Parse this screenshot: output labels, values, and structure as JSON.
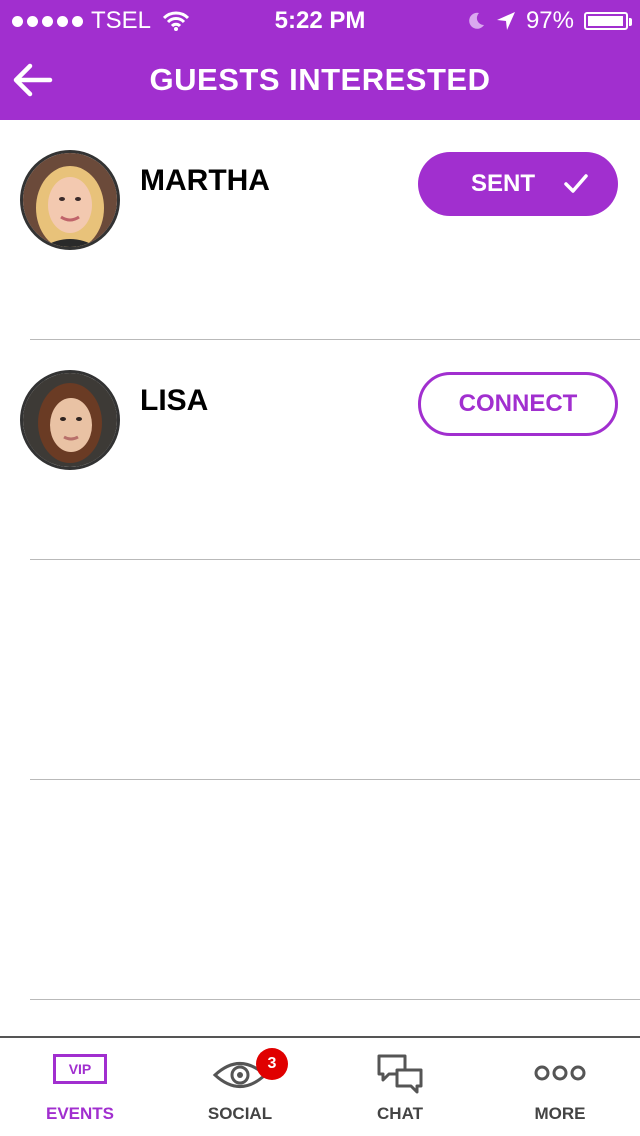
{
  "status_bar": {
    "carrier": "TSEL",
    "time": "5:22 PM",
    "battery": "97%",
    "battery_level": 0.97,
    "icons": [
      "signal-dots-icon",
      "wifi-icon",
      "moon-icon",
      "location-arrow-icon",
      "battery-icon"
    ]
  },
  "nav": {
    "title": "GUESTS INTERESTED",
    "back_icon": "back-arrow-icon"
  },
  "guests": [
    {
      "name": "MARTHA",
      "action": "SENT",
      "state": "sent",
      "icon": "checkmark-icon"
    },
    {
      "name": "LISA",
      "action": "CONNECT",
      "state": "connect"
    }
  ],
  "tabbar": {
    "tabs": [
      {
        "label": "EVENTS",
        "icon": "vip-icon",
        "icon_text": "VIP",
        "active": true
      },
      {
        "label": "SOCIAL",
        "icon": "eye-icon",
        "badge": "3",
        "active": false
      },
      {
        "label": "CHAT",
        "icon": "chat-bubbles-icon",
        "active": false
      },
      {
        "label": "MORE",
        "icon": "more-dots-icon",
        "active": false
      }
    ]
  },
  "colors": {
    "accent": "#a12fcf",
    "badge": "#e00000",
    "divider": "#b9b9b9"
  }
}
